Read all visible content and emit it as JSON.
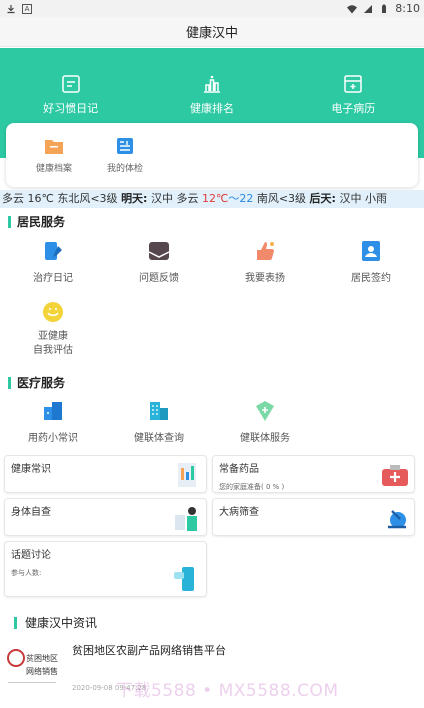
{
  "status_bar": {
    "a_badge": "A",
    "time": "8:10"
  },
  "title": "健康汉中",
  "hero": [
    {
      "label": "好习惯日记",
      "icon": "diary-icon"
    },
    {
      "label": "健康排名",
      "icon": "ranking-icon"
    },
    {
      "label": "电子病历",
      "icon": "medical-record-icon"
    }
  ],
  "card": [
    {
      "label": "健康档案",
      "icon": "folder-icon"
    },
    {
      "label": "我的体检",
      "icon": "checkup-icon"
    }
  ],
  "weather": {
    "seg1": "多云 16℃ 东北风<3级",
    "tomorrow_label": "明天:",
    "city": "汉中",
    "cond": "多云",
    "t_high": "12℃",
    "sep": "～",
    "t_low": "22",
    "wind": "南风<3级",
    "after_label": "后天:",
    "city2": "汉中",
    "cond2": "小雨"
  },
  "resident": {
    "title": "居民服务",
    "items": [
      {
        "label": "治疗日记",
        "icon": "phone-pen-icon"
      },
      {
        "label": "问题反馈",
        "icon": "mail-icon"
      },
      {
        "label": "我要表扬",
        "icon": "thumbs-up-icon"
      },
      {
        "label": "居民签约",
        "icon": "contract-icon"
      }
    ],
    "extra": {
      "line1": "亚健康",
      "line2": "自我评估",
      "icon": "smile-face-icon"
    }
  },
  "medical": {
    "title": "医疗服务",
    "items": [
      {
        "label": "用药小常识",
        "icon": "medicine-box-icon"
      },
      {
        "label": "健联体查询",
        "icon": "building-icon"
      },
      {
        "label": "健联体服务",
        "icon": "shield-plus-icon"
      }
    ]
  },
  "tiles": [
    {
      "label": "健康常识",
      "sub": ""
    },
    {
      "label": "常备药品",
      "sub": "您的家庭准备( 0 % )"
    },
    {
      "label": "身体自查",
      "sub": ""
    },
    {
      "label": "大病筛查",
      "sub": ""
    },
    {
      "label": "话题讨论",
      "sub": "参与人数:"
    }
  ],
  "news": {
    "title": "健康汉中资讯",
    "headline": "贫困地区农副产品网络销售平台",
    "thumb_line1": "贫困地区农副产品",
    "thumb_line2": "网络销售平台",
    "date": "2020-09-08 09:47:28",
    "watermark": "下载5588 • MX5588.COM"
  },
  "colors": {
    "primary": "#2cc9a3",
    "weather_bg": "#e1f0fa",
    "red": "#e23a3a",
    "blue": "#2a8ae0"
  }
}
